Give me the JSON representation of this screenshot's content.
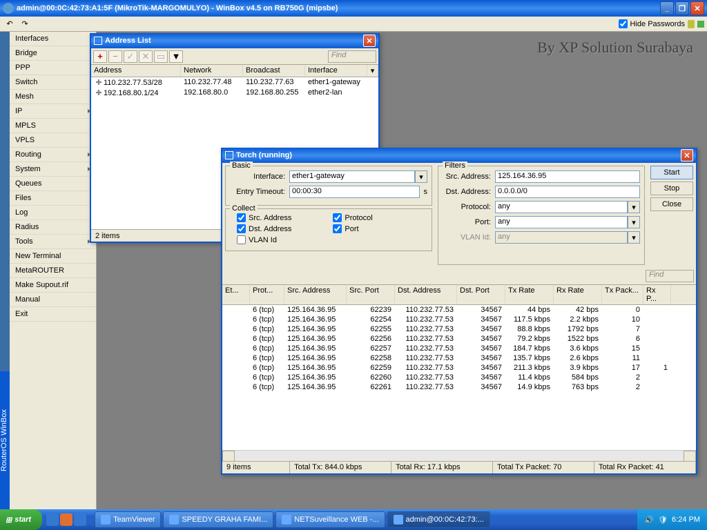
{
  "titlebar": "admin@00:0C:42:73:A1:5F (MikroTik-MARGOMULYO) - WinBox v4.5 on RB750G (mipsbe)",
  "hide_passwords": "Hide Passwords",
  "vertbar": "RouterOS WinBox",
  "watermark": "By XP Solution Surabaya",
  "menu": [
    "Interfaces",
    "Bridge",
    "PPP",
    "Switch",
    "Mesh",
    "IP",
    "MPLS",
    "VPLS",
    "Routing",
    "System",
    "Queues",
    "Files",
    "Log",
    "Radius",
    "Tools",
    "New Terminal",
    "MetaROUTER",
    "Make Supout.rif",
    "Manual",
    "Exit"
  ],
  "menu_sub": [
    false,
    false,
    false,
    false,
    false,
    true,
    false,
    false,
    true,
    true,
    false,
    false,
    false,
    false,
    true,
    false,
    false,
    false,
    false,
    false
  ],
  "addrwin": {
    "title": "Address List",
    "find": "Find",
    "cols": [
      "Address",
      "Network",
      "Broadcast",
      "Interface"
    ],
    "rows": [
      [
        "110.232.77.53/28",
        "110.232.77.48",
        "110.232.77.63",
        "ether1-gateway"
      ],
      [
        "192.168.80.1/24",
        "192.168.80.0",
        "192.168.80.255",
        "ether2-lan"
      ]
    ],
    "status": "2 items"
  },
  "torch": {
    "title": "Torch (running)",
    "basic": "Basic",
    "filters": "Filters",
    "collect": "Collect",
    "labels": {
      "interface": "Interface:",
      "entry_timeout": "Entry Timeout:",
      "src_addr": "Src. Address:",
      "dst_addr": "Dst. Address:",
      "protocol": "Protocol:",
      "port": "Port:",
      "vlanid": "VLAN Id:",
      "s_unit": "s"
    },
    "values": {
      "interface": "ether1-gateway",
      "entry_timeout": "00:00:30",
      "src_addr": "125.164.36.95",
      "dst_addr": "0.0.0.0/0",
      "protocol": "any",
      "port": "any",
      "vlanid": "any"
    },
    "buttons": {
      "start": "Start",
      "stop": "Stop",
      "close": "Close"
    },
    "collect_items": {
      "src": "Src. Address",
      "dst": "Dst. Address",
      "vlan": "VLAN Id",
      "proto": "Protocol",
      "port": "Port"
    },
    "find": "Find",
    "cols": [
      "Et...",
      "Prot...",
      "Src. Address",
      "Src. Port",
      "Dst. Address",
      "Dst. Port",
      "Tx Rate",
      "Rx Rate",
      "Tx Pack...",
      "Rx P..."
    ],
    "rows": [
      [
        "",
        "6 (tcp)",
        "125.164.36.95",
        "62239",
        "110.232.77.53",
        "34567",
        "44 bps",
        "42 bps",
        "0",
        ""
      ],
      [
        "",
        "6 (tcp)",
        "125.164.36.95",
        "62254",
        "110.232.77.53",
        "34567",
        "117.5 kbps",
        "2.2 kbps",
        "10",
        ""
      ],
      [
        "",
        "6 (tcp)",
        "125.164.36.95",
        "62255",
        "110.232.77.53",
        "34567",
        "88.8 kbps",
        "1792 bps",
        "7",
        ""
      ],
      [
        "",
        "6 (tcp)",
        "125.164.36.95",
        "62256",
        "110.232.77.53",
        "34567",
        "79.2 kbps",
        "1522 bps",
        "6",
        ""
      ],
      [
        "",
        "6 (tcp)",
        "125.164.36.95",
        "62257",
        "110.232.77.53",
        "34567",
        "184.7 kbps",
        "3.6 kbps",
        "15",
        ""
      ],
      [
        "",
        "6 (tcp)",
        "125.164.36.95",
        "62258",
        "110.232.77.53",
        "34567",
        "135.7 kbps",
        "2.6 kbps",
        "11",
        ""
      ],
      [
        "",
        "6 (tcp)",
        "125.164.36.95",
        "62259",
        "110.232.77.53",
        "34567",
        "211.3 kbps",
        "3.9 kbps",
        "17",
        "1"
      ],
      [
        "",
        "6 (tcp)",
        "125.164.36.95",
        "62260",
        "110.232.77.53",
        "34567",
        "11.4 kbps",
        "584 bps",
        "2",
        ""
      ],
      [
        "",
        "6 (tcp)",
        "125.164.36.95",
        "62261",
        "110.232.77.53",
        "34567",
        "14.9 kbps",
        "763 bps",
        "2",
        ""
      ]
    ],
    "status": [
      "9 items",
      "Total Tx: 844.0 kbps",
      "Total Rx: 17.1 kbps",
      "Total Tx Packet: 70",
      "Total Rx Packet: 41"
    ]
  },
  "taskbar": {
    "start": "start",
    "tasks": [
      "TeamViewer",
      "SPEEDY GRAHA FAMI...",
      "NETSuveillance WEB -...",
      "admin@00:0C:42:73:..."
    ],
    "clock": "6:24 PM"
  }
}
